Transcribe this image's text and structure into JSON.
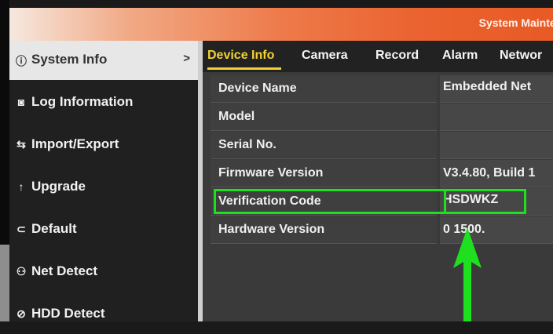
{
  "header": {
    "title": "System Maintens"
  },
  "sidebar": {
    "items": [
      {
        "label": "System Info",
        "icon": "info-icon",
        "active": true,
        "chevron": ">"
      },
      {
        "label": "Log Information",
        "icon": "log-icon"
      },
      {
        "label": "Import/Export",
        "icon": "import-export-icon"
      },
      {
        "label": "Upgrade",
        "icon": "upgrade-icon"
      },
      {
        "label": "Default",
        "icon": "default-icon"
      },
      {
        "label": "Net Detect",
        "icon": "net-detect-icon"
      },
      {
        "label": "HDD Detect",
        "icon": "hdd-detect-icon"
      }
    ]
  },
  "tabs": [
    "Device Info",
    "Camera",
    "Record",
    "Alarm",
    "Networ"
  ],
  "active_tab": "Device Info",
  "device_info": [
    {
      "label": "Device Name",
      "value": "Embedded Net"
    },
    {
      "label": "Model",
      "value": ""
    },
    {
      "label": "Serial No.",
      "value": ""
    },
    {
      "label": "Firmware Version",
      "value": "V3.4.80, Build 1"
    },
    {
      "label": "Verification Code",
      "value": "HSDWKZ"
    },
    {
      "label": "Hardware Version",
      "value": "0 1500."
    }
  ],
  "colors": {
    "highlight": "#1fe01f",
    "active_tab": "#f4d233",
    "header_accent": "#ea6330"
  }
}
